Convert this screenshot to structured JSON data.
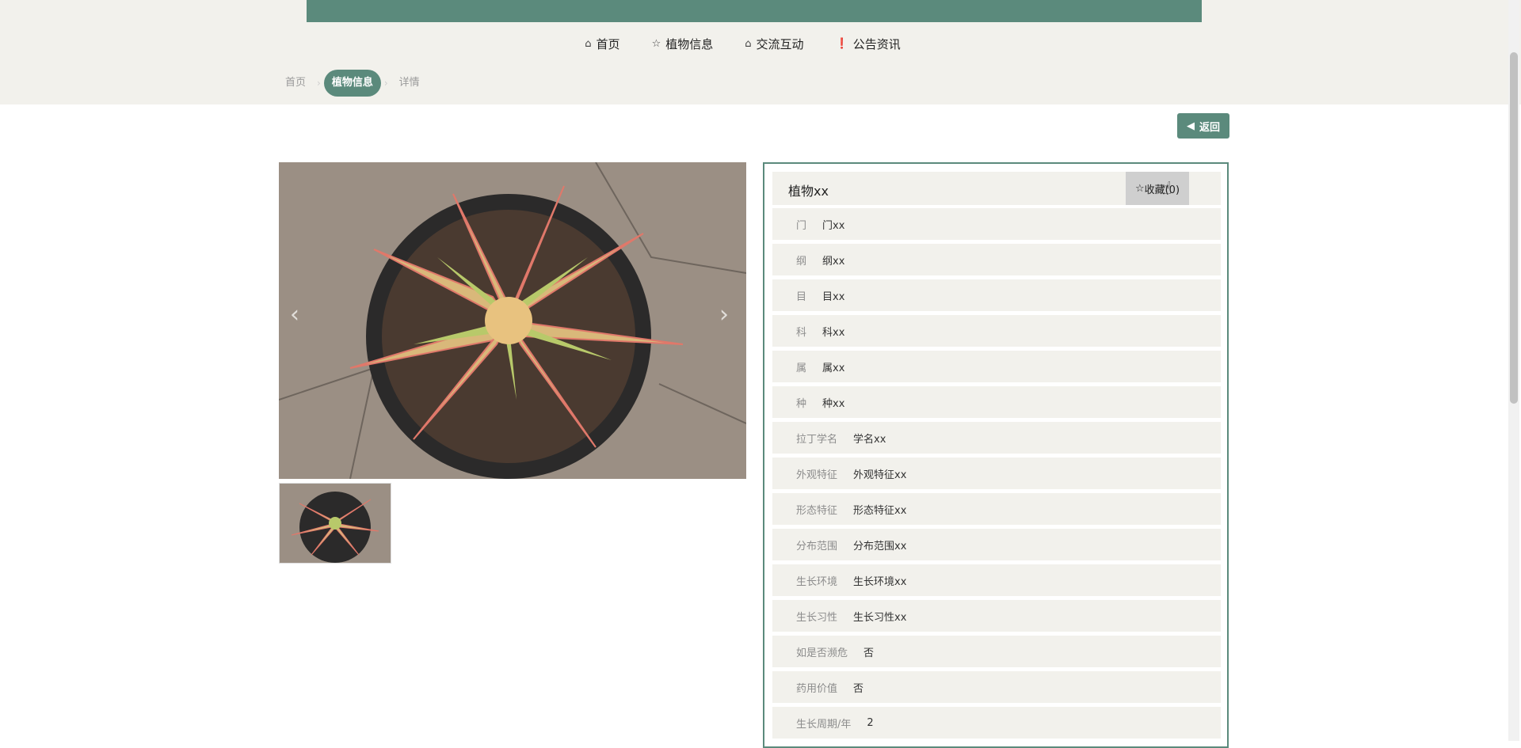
{
  "nav": {
    "items": [
      {
        "icon": "home-icon",
        "label": "首页"
      },
      {
        "icon": "star-icon",
        "label": "植物信息"
      },
      {
        "icon": "bag-icon",
        "label": "交流互动"
      },
      {
        "icon": "alert-icon",
        "label": "公告资讯"
      }
    ]
  },
  "breadcrumb": {
    "items": [
      "首页",
      "植物信息",
      "详情"
    ],
    "active_index": 1
  },
  "back_label": "返回",
  "detail": {
    "title": "植物xx",
    "favorite_label": "收藏(0)",
    "rows": [
      {
        "label": "门",
        "value": "门xx"
      },
      {
        "label": "纲",
        "value": "纲xx"
      },
      {
        "label": "目",
        "value": "目xx"
      },
      {
        "label": "科",
        "value": "科xx"
      },
      {
        "label": "属",
        "value": "属xx"
      },
      {
        "label": "种",
        "value": "种xx"
      },
      {
        "label": "拉丁学名",
        "value": "学名xx"
      },
      {
        "label": "外观特征",
        "value": "外观特征xx"
      },
      {
        "label": "形态特征",
        "value": "形态特征xx"
      },
      {
        "label": "分布范围",
        "value": "分布范围xx"
      },
      {
        "label": "生长环境",
        "value": "生长环境xx"
      },
      {
        "label": "生长习性",
        "value": "生长习性xx"
      },
      {
        "label": "如是否濒危",
        "value": "否"
      },
      {
        "label": "药用价值",
        "value": "否"
      },
      {
        "label": "生长周期/年",
        "value": "2"
      }
    ]
  },
  "colors": {
    "accent": "#5b8a7c",
    "band": "#f2f1ec"
  }
}
